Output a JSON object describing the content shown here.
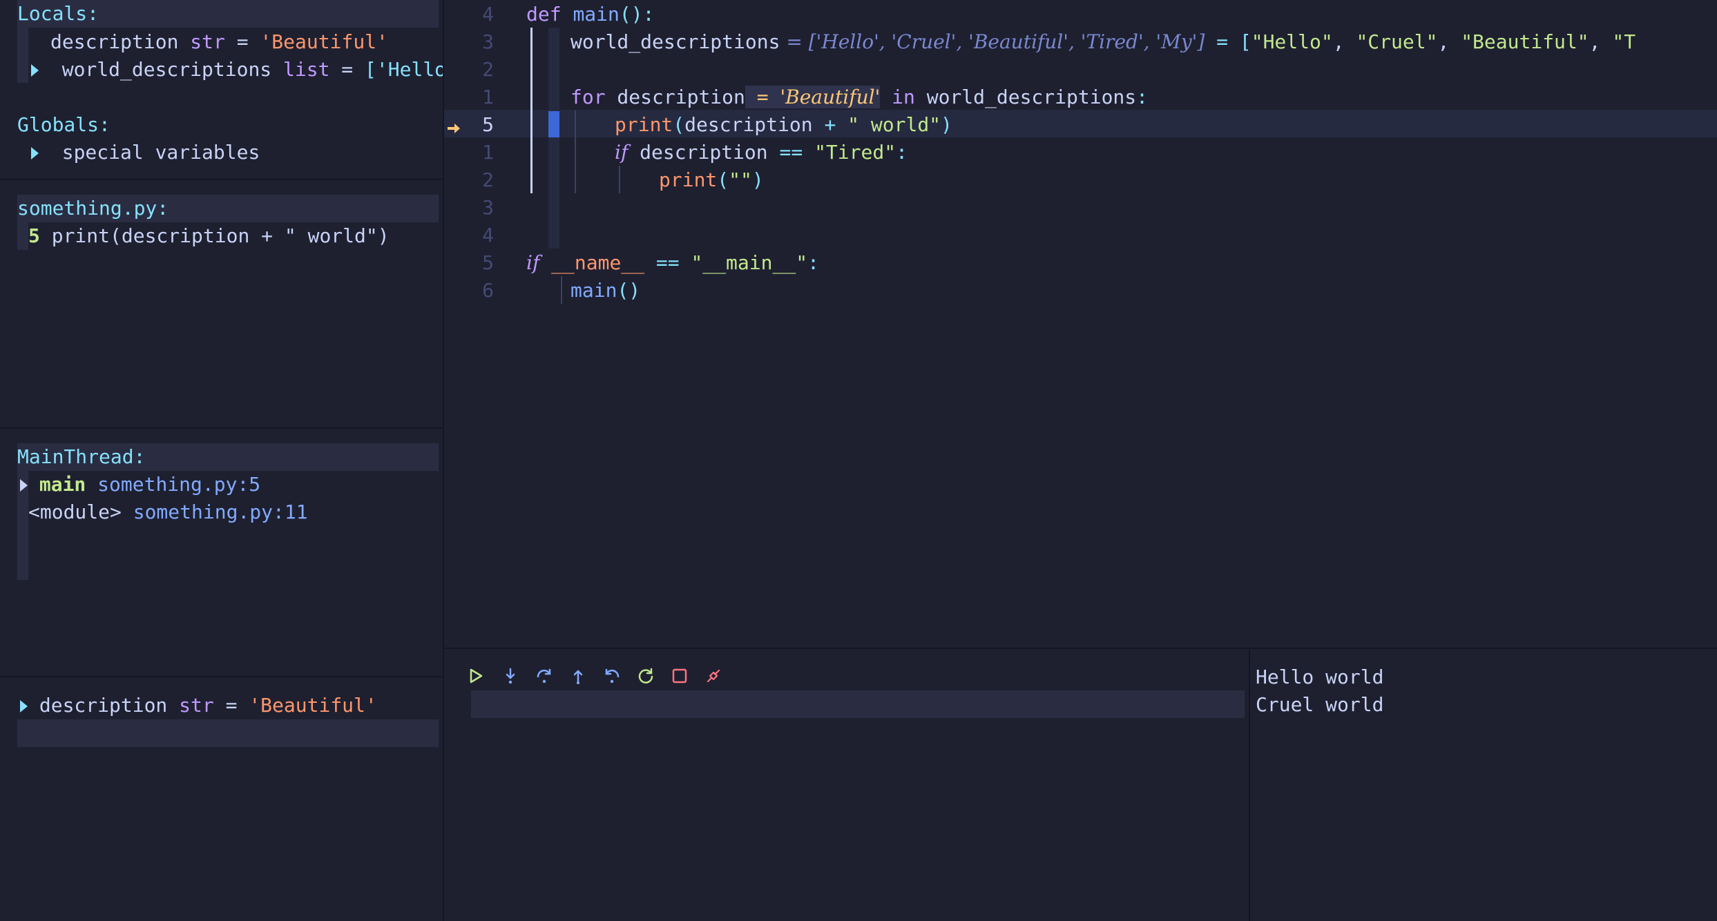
{
  "variables": {
    "locals_header": "Locals:",
    "locals": [
      {
        "name": "description",
        "type": "str",
        "eq": " = ",
        "value": "'Beautiful'"
      },
      {
        "name": "world_descriptions",
        "type": "list",
        "eq": " = ",
        "value": "['Hello',"
      }
    ],
    "globals_header": "Globals:",
    "globals": [
      {
        "name": "special variables"
      }
    ]
  },
  "breakpoints": {
    "file_header": "something.py:",
    "items": [
      {
        "line": "5",
        "code": "print(description + \" world\")"
      }
    ]
  },
  "stacks": {
    "thread_header": "MainThread:",
    "frames": [
      {
        "func": "main",
        "location": "something.py:5"
      },
      {
        "func": "<module>",
        "location": "something.py:11"
      }
    ]
  },
  "watches": {
    "items": [
      {
        "name": "description",
        "type": "str",
        "eq": " = ",
        "value": "'Beautiful'"
      }
    ]
  },
  "editor": {
    "line_numbers": [
      "4",
      "3",
      "2",
      "1",
      "5",
      "1",
      "2",
      "3",
      "4",
      "5",
      "6"
    ],
    "current_line_number": "5",
    "code": {
      "l0_kw": "def",
      "l0_fn": "main",
      "l0_rest": "():",
      "l1_name": "world_descriptions",
      "l1_virtual": " = ['Hello', 'Cruel', 'Beautiful', 'Tired', 'My']",
      "l1_eq": " = [",
      "l1_s1": "\"Hello\"",
      "l1_c1": ", ",
      "l1_s2": "\"Cruel\"",
      "l1_c2": ", ",
      "l1_s3": "\"Beautiful\"",
      "l1_c3": ", ",
      "l1_s4": "\"T",
      "l3_kw": "for",
      "l3_name": " description",
      "l3_virtual_eq": " = ",
      "l3_virtual_val": "'Beautiful'",
      "l3_in": " in",
      "l3_rest": " world_descriptions",
      "l3_colon": ":",
      "l4_fn": "print",
      "l4_open": "(",
      "l4_arg": "description",
      "l4_plus": " + ",
      "l4_str": "\" world\"",
      "l4_close": ")",
      "l5_kw": "if",
      "l5_name": " description",
      "l5_op": " == ",
      "l5_str": "\"Tired\"",
      "l5_colon": ":",
      "l6_fn": "print",
      "l6_open": "(",
      "l6_str": "\"\"",
      "l6_close": ")",
      "l9_kw": "if",
      "l9_name": " __name__",
      "l9_op": " == ",
      "l9_str": "\"__main__\"",
      "l9_colon": ":",
      "l10_fn": "main",
      "l10_rest": "()"
    }
  },
  "controls": {
    "icons": [
      "play-icon",
      "step-into-icon",
      "step-over-icon",
      "step-out-icon",
      "step-back-icon",
      "restart-icon",
      "stop-icon",
      "disconnect-icon"
    ]
  },
  "console": {
    "lines": [
      "Hello world",
      "Cruel world"
    ]
  },
  "colors": {
    "background": "#1e2030",
    "panel_header": "#2a2d42",
    "cursorline": "#262a40",
    "accent_cyan": "#86e1fc",
    "accent_orange": "#ff966c",
    "accent_green": "#c3e88d",
    "accent_purple": "#c099ff",
    "accent_blue": "#82aaff",
    "accent_yellow": "#ffc777",
    "accent_red": "#ff757f"
  }
}
